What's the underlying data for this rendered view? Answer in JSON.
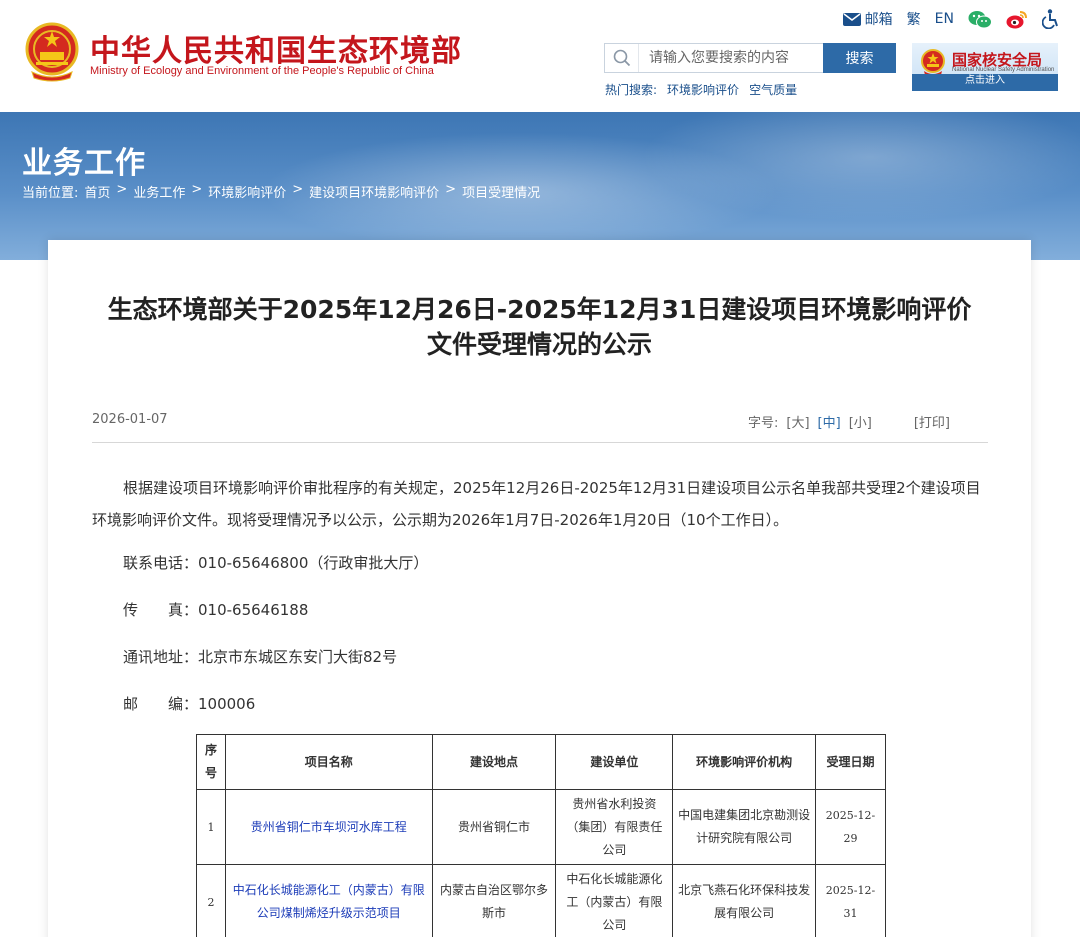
{
  "header": {
    "brand_cn": "中华人民共和国生态环境部",
    "brand_en": "Ministry of Ecology and Environment of the People's Republic of China",
    "toplinks": {
      "mail": "邮箱",
      "traditional": "繁",
      "english": "EN"
    },
    "search": {
      "placeholder": "请输入您要搜索的内容",
      "button": "搜索",
      "hot_label": "热门搜索:",
      "hot_items": [
        "环境影响评价",
        "空气质量"
      ]
    },
    "nnsa": {
      "title": "国家核安全局",
      "subtitle": "National Nuclear Safety Administration",
      "enter": "点击进入"
    }
  },
  "banner": {
    "section_title": "业务工作",
    "breadcrumb": [
      "当前位置:",
      "首页",
      ">",
      "业务工作",
      ">",
      "环境影响评价",
      ">",
      "建设项目环境影响评价",
      ">",
      "项目受理情况"
    ]
  },
  "article": {
    "title_line1": "生态环境部关于2025年12月26日-2025年12月31日建设项目环境影响评价",
    "title_line2": "文件受理情况的公示",
    "date": "2026-01-07",
    "font_label": "字号:",
    "font_large": "[大]",
    "font_medium": "[中]",
    "font_small": "[小]",
    "print": "[打印]",
    "paragraph": "根据建设项目环境影响评价审批程序的有关规定，2025年12月26日-2025年12月31日建设项目公示名单我部共受理2个建设项目环境影响评价文件。现将受理情况予以公示，公示期为2026年1月7日-2026年1月20日（10个工作日）。",
    "phone": "联系电话：010-65646800（行政审批大厅）",
    "fax": "传　　真：010-65646188",
    "address": "通讯地址：北京市东城区东安门大街82号",
    "postcode": "邮　　编：100006"
  },
  "table": {
    "headers": [
      "序号",
      "项目名称",
      "建设地点",
      "建设单位",
      "环境影响评价机构",
      "受理日期"
    ],
    "rows": [
      {
        "num": "1",
        "name": "贵州省铜仁市车坝河水库工程",
        "location": "贵州省铜仁市",
        "builder": "贵州省水利投资（集团）有限责任公司",
        "agency": "中国电建集团北京勘测设计研究院有限公司",
        "date": "2025-12-29"
      },
      {
        "num": "2",
        "name": "中石化长城能源化工（内蒙古）有限公司煤制烯烃升级示范项目",
        "location": "内蒙古自治区鄂尔多斯市",
        "builder": "中石化长城能源化工（内蒙古）有限公司",
        "agency": "北京飞燕石化环保科技发展有限公司",
        "date": "2025-12-31"
      }
    ]
  },
  "colors": {
    "brand_red": "#c4161c",
    "link_blue": "#1a4f8b",
    "button_blue": "#2d6aa7"
  }
}
